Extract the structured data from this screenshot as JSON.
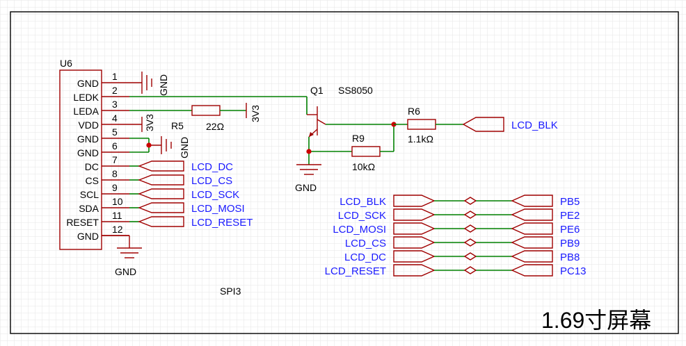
{
  "colors": {
    "wire": "#008000",
    "component": "#a00000",
    "netlabel": "#1a1aff",
    "junction": "#cc0000",
    "grid": "#e6e6e6",
    "frame": "#000000"
  },
  "connector": {
    "ref": "U6",
    "pins": [
      {
        "num": "1",
        "name": "GND"
      },
      {
        "num": "2",
        "name": "LEDK"
      },
      {
        "num": "3",
        "name": "LEDA"
      },
      {
        "num": "4",
        "name": "VDD"
      },
      {
        "num": "5",
        "name": "GND"
      },
      {
        "num": "6",
        "name": "GND"
      },
      {
        "num": "7",
        "name": "DC"
      },
      {
        "num": "8",
        "name": "CS"
      },
      {
        "num": "9",
        "name": "SCL"
      },
      {
        "num": "10",
        "name": "SDA"
      },
      {
        "num": "11",
        "name": "RESET"
      },
      {
        "num": "12",
        "name": "GND"
      }
    ],
    "net_labels": [
      "LCD_DC",
      "LCD_CS",
      "LCD_SCK",
      "LCD_MOSI",
      "LCD_RESET"
    ]
  },
  "power": {
    "gnd1": "GND",
    "gnd2": "GND",
    "gnd_bottom": "GND",
    "gnd_q1": "GND",
    "v3v3_r": "3V3",
    "v3v3_pin4": "3V3"
  },
  "resistors": {
    "r5": {
      "ref": "R5",
      "value": "22Ω"
    },
    "r6": {
      "ref": "R6",
      "value": "1.1kΩ"
    },
    "r9": {
      "ref": "R9",
      "value": "10kΩ"
    }
  },
  "transistor": {
    "ref": "Q1",
    "part": "SS8050"
  },
  "blk_label": "LCD_BLK",
  "mapping": [
    {
      "from": "LCD_BLK",
      "to": "PB5"
    },
    {
      "from": "LCD_SCK",
      "to": "PE2"
    },
    {
      "from": "LCD_MOSI",
      "to": "PE6"
    },
    {
      "from": "LCD_CS",
      "to": "PB9"
    },
    {
      "from": "LCD_DC",
      "to": "PB8"
    },
    {
      "from": "LCD_RESET",
      "to": "PC13"
    }
  ],
  "bus_note": "SPI3",
  "sheet_title": "1.69寸屏幕"
}
